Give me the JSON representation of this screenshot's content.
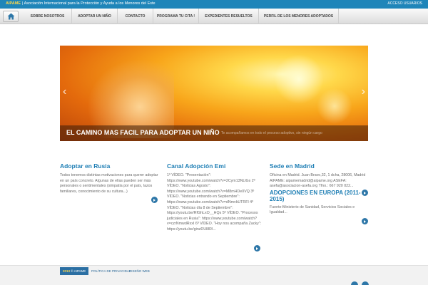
{
  "topbar": {
    "brand": "AIPAME",
    "brand_desc": "Asociación Internacional para la Protección y Ayuda a los Menores del Este",
    "login": "ACCESO USUARIOS"
  },
  "nav": {
    "items": [
      "SOBRE NOSOTROS",
      "ADOPTAR UN NIÑO",
      "CONTACTO",
      "PROGRAMA TU CITA !",
      "EXPEDIENTES RESUELTOS",
      "PERFIL DE LOS MENORES ADOPTADOS"
    ]
  },
  "slider": {
    "title": "EL CAMINO MAS FACIL PARA ADOPTAR UN NIÑO",
    "subtitle": "Te acompañamos en todo el proceso adoptivo, sin ningún cargo",
    "prev": "‹",
    "next": "›"
  },
  "columns": {
    "rusia": {
      "title": "Adoptar en Rusia",
      "text": "Todos tenemos distintas motivaciones para querer adoptar en un país concreto. Algunas de ellas pueden ser más personales o sentimentales (simpatía por el país, lazos familiares, conocimiento de su cultura...)"
    },
    "canal": {
      "title": "Canal Adopción Emi",
      "text": "1º VÍDEO. \"Presentación\": https://www.youtube.com/watch?v=2Cym13NLlGs 2º VÍDEO. \"Noticias Agosto\": https://www.youtube.com/watch?v=M8mHDe0VQ 3º VÍDEO. \"Noticias entrando en Septiembre\": https://www.youtube.com/watch?v=dNmvkUTRFl 4º VÍDEO. \"Noticias día 8 de Septiembre\": https://youtu.be/RfGhLxO__HQs 5º VÍDEO. \"Procesos judiciales en Rusia\": https://www.youtube.com/watch?v=czrNmwdRxxI 6º VÍDEO. \"Hoy nos acompaña Zacky\": https://youtu.be/ginzDUl8RI..."
    },
    "sede": {
      "title": "Sede en Madrid",
      "text": "Oficina en Madrid. Juan Bravo,32, 1 dcha, 28006, Madrid AIPAME: aipamemadrid@aipame.org ASEFA: asefa@asociacion-asefa.org Tfno.: 667 920 022...",
      "sub_title": "ADOPCIONES EN EUROPA (2011-2015)",
      "sub_text": "Fuente:Ministerio de Sanidad, Servicios Sociales e Igualdad..."
    }
  },
  "footer": {
    "year": "2013",
    "brand": "AIPAME",
    "links": [
      "POLÍTICA DE PRIVACIDAD",
      "DISEÑO WEB"
    ]
  },
  "colors": {
    "accent": "#1f85b9",
    "heading": "#1f7fb5",
    "brand_yellow": "#ffd84a"
  }
}
